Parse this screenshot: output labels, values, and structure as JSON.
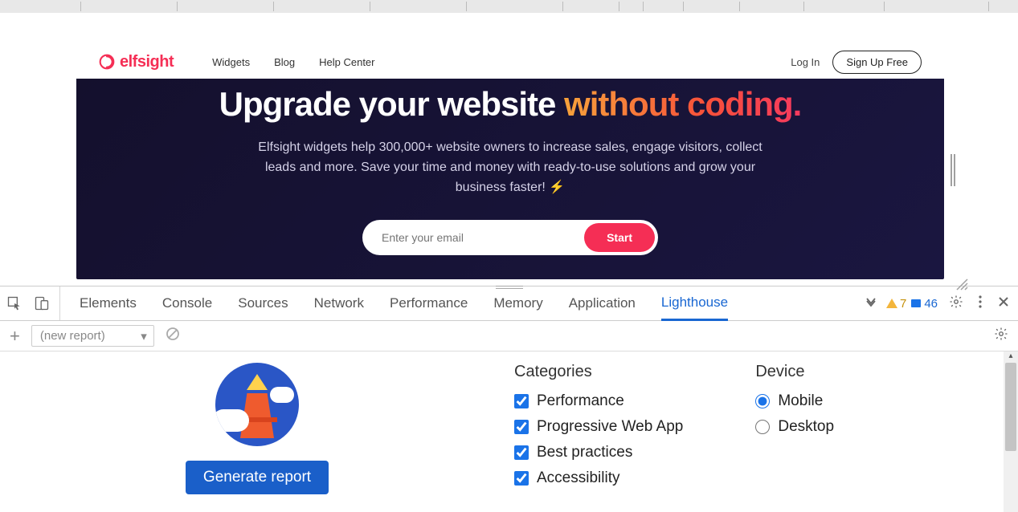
{
  "site": {
    "brand": "elfsight",
    "nav": [
      "Widgets",
      "Blog",
      "Help Center"
    ],
    "login": "Log In",
    "signup": "Sign Up Free"
  },
  "hero": {
    "h1_a": "Upgrade your website ",
    "h1_b": "without coding.",
    "sub": "Elfsight widgets help 300,000+ website owners to increase sales, engage visitors, collect leads and more. Save your time and money with ready-to-use solutions and grow your business faster! ⚡",
    "email_placeholder": "Enter your email",
    "start": "Start"
  },
  "devtools": {
    "tabs": [
      "Elements",
      "Console",
      "Sources",
      "Network",
      "Performance",
      "Memory",
      "Application",
      "Lighthouse"
    ],
    "active_tab": "Lighthouse",
    "warn_count": "7",
    "info_count": "46",
    "new_report": "(new report)"
  },
  "lighthouse": {
    "generate": "Generate report",
    "categories_label": "Categories",
    "device_label": "Device",
    "categories": [
      "Performance",
      "Progressive Web App",
      "Best practices",
      "Accessibility"
    ],
    "devices": [
      "Mobile",
      "Desktop"
    ]
  }
}
